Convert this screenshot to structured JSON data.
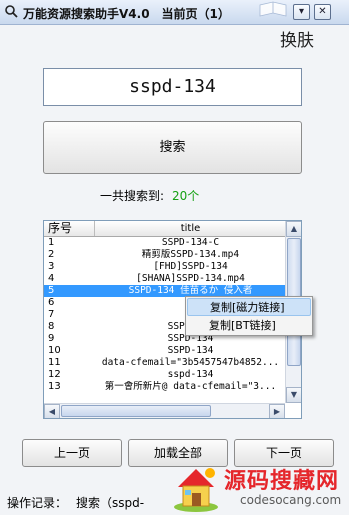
{
  "window": {
    "title": "万能资源搜索助手V4.0　当前页（1）",
    "minimize_glyph": "▾",
    "close_glyph": "✕"
  },
  "skin_button": "换肤",
  "search": {
    "value": "sspd-134",
    "button": "搜索"
  },
  "result_count": {
    "label": "一共搜索到:",
    "value": "20个"
  },
  "list": {
    "columns": [
      "序号",
      "title"
    ],
    "rows": [
      {
        "n": "1",
        "t": "SSPD-134-C"
      },
      {
        "n": "2",
        "t": "精剪版SSPD-134.mp4"
      },
      {
        "n": "3",
        "t": "[FHD]SSPD-134"
      },
      {
        "n": "4",
        "t": "[SHANA]SSPD-134.mp4"
      },
      {
        "n": "5",
        "t": "SSPD-134 佳苗るか 侵入者"
      },
      {
        "n": "6",
        "t": "[S"
      },
      {
        "n": "7",
        "t": "S"
      },
      {
        "n": "8",
        "t": "SSPD-134"
      },
      {
        "n": "9",
        "t": "SSPD-134"
      },
      {
        "n": "10",
        "t": "SSPD-134"
      },
      {
        "n": "11",
        "t": "data-cfemail=\"3b5457547b4852..."
      },
      {
        "n": "12",
        "t": "sspd-134"
      },
      {
        "n": "13",
        "t": "第一會所新片@ data-cfemail=\"3..."
      }
    ],
    "selected_index": 4
  },
  "context_menu": [
    "复制[磁力链接]",
    "复制[BT链接]"
  ],
  "buttons": {
    "prev": "上一页",
    "load_all": "加载全部",
    "next": "下一页"
  },
  "log": {
    "label": "操作记录：",
    "value": "搜索（sspd-"
  },
  "watermark": {
    "text": "源码搜藏网",
    "url": "codesocang.com"
  },
  "colors": {
    "count_green": "#16a014",
    "selection": "#3399ff",
    "watermark_red": "#e5262b"
  },
  "icons": [
    "search-icon",
    "book-icon",
    "minimize-icon",
    "close-icon",
    "house-icon"
  ]
}
